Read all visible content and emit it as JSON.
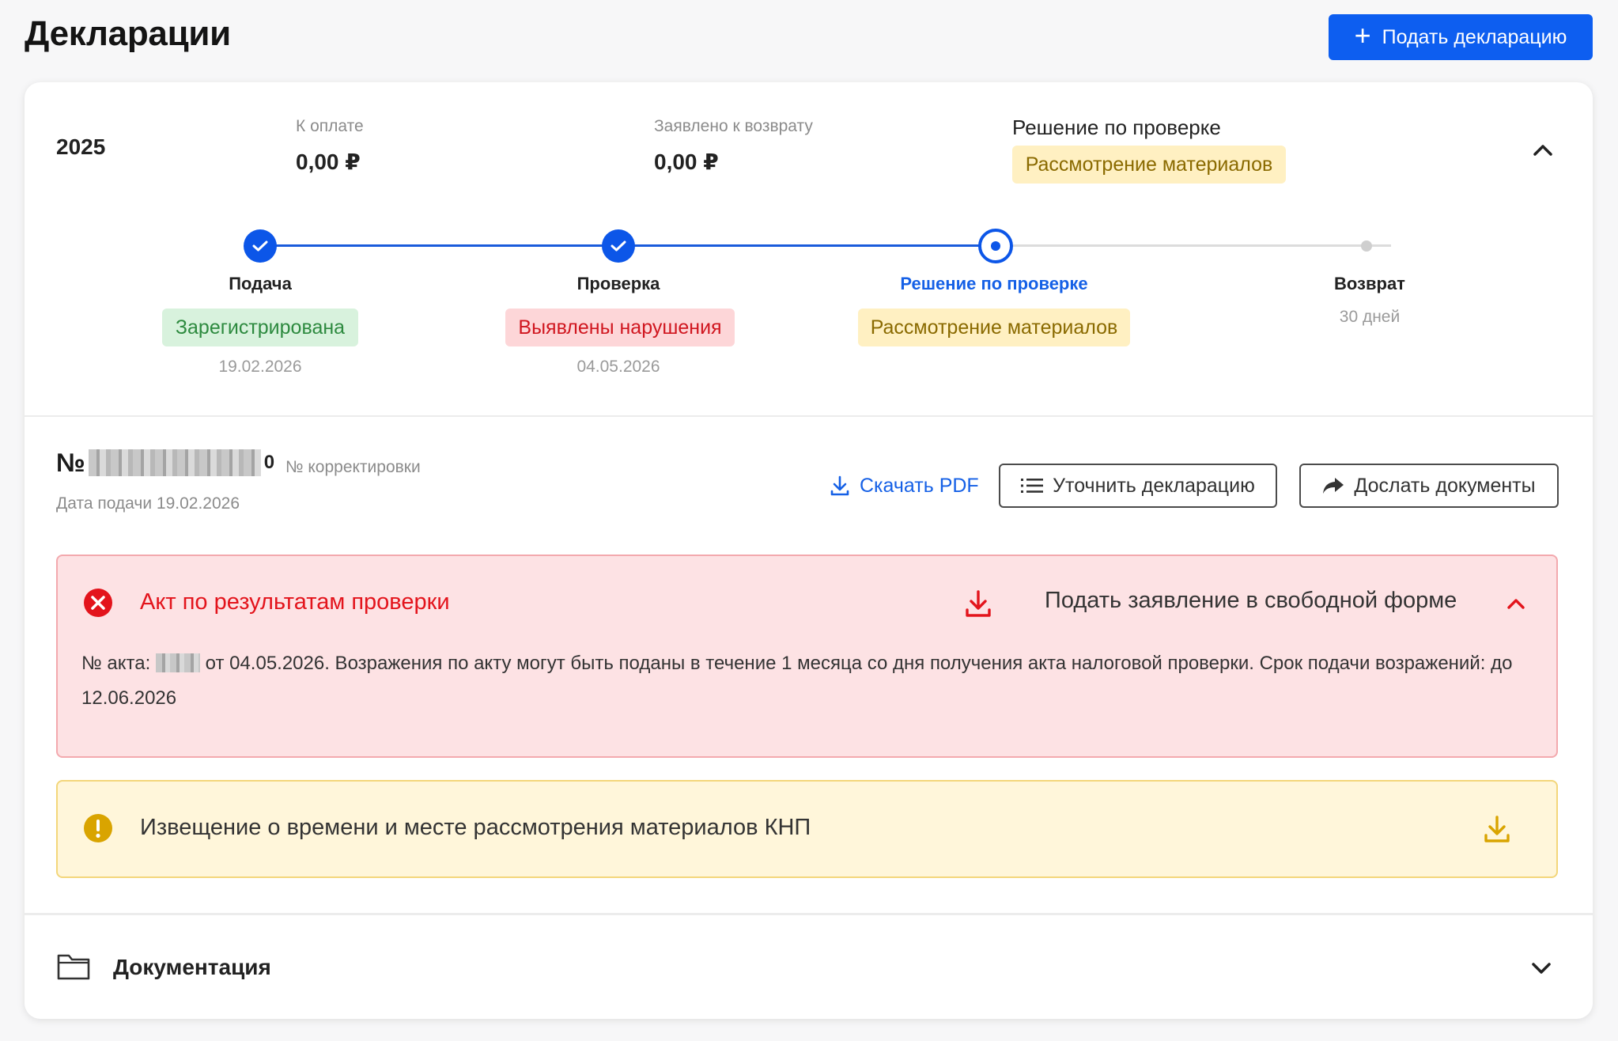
{
  "header": {
    "title": "Декларации",
    "add_button": "Подать декларацию"
  },
  "declaration": {
    "year": "2025",
    "to_pay_label": "К оплате",
    "to_pay_value": "0,00 ₽",
    "refund_label": "Заявлено к возврату",
    "refund_value": "0,00 ₽",
    "decision_label": "Решение по проверке",
    "decision_status": "Рассмотрение материалов"
  },
  "steps": [
    {
      "title": "Подача",
      "status": "Зарегистрирована",
      "date": "19.02.2026",
      "state": "done"
    },
    {
      "title": "Проверка",
      "status": "Выявлены нарушения",
      "date": "04.05.2026",
      "state": "done"
    },
    {
      "title": "Решение по проверке",
      "status": "Рассмотрение материалов",
      "date": "",
      "state": "current"
    },
    {
      "title": "Возврат",
      "status": "",
      "date": "30 дней",
      "state": "future"
    }
  ],
  "document": {
    "number_prefix": "№",
    "correction_number": "0",
    "correction_label": "№ корректировки",
    "filed_date": "Дата подачи 19.02.2026",
    "download_pdf": "Скачать PDF",
    "clarify_button": "Уточнить декларацию",
    "send_docs_button": "Дослать документы"
  },
  "alert_act": {
    "title": "Акт по результатам проверки",
    "action": "Подать заявление в свободной форме",
    "body_prefix": "№ акта:",
    "body_text": "от 04.05.2026. Возражения по акту могут быть поданы в течение 1 месяца со дня получения акта налоговой проверки. Срок подачи возражений: до 12.06.2026"
  },
  "alert_notice": {
    "title": "Извещение о времени и месте рассмотрения материалов КНП"
  },
  "documentation": {
    "title": "Документация"
  },
  "colors": {
    "primary": "#0d5ef0",
    "error": "#e3141c",
    "warning": "#d9a400",
    "success": "#2d8a3f"
  }
}
